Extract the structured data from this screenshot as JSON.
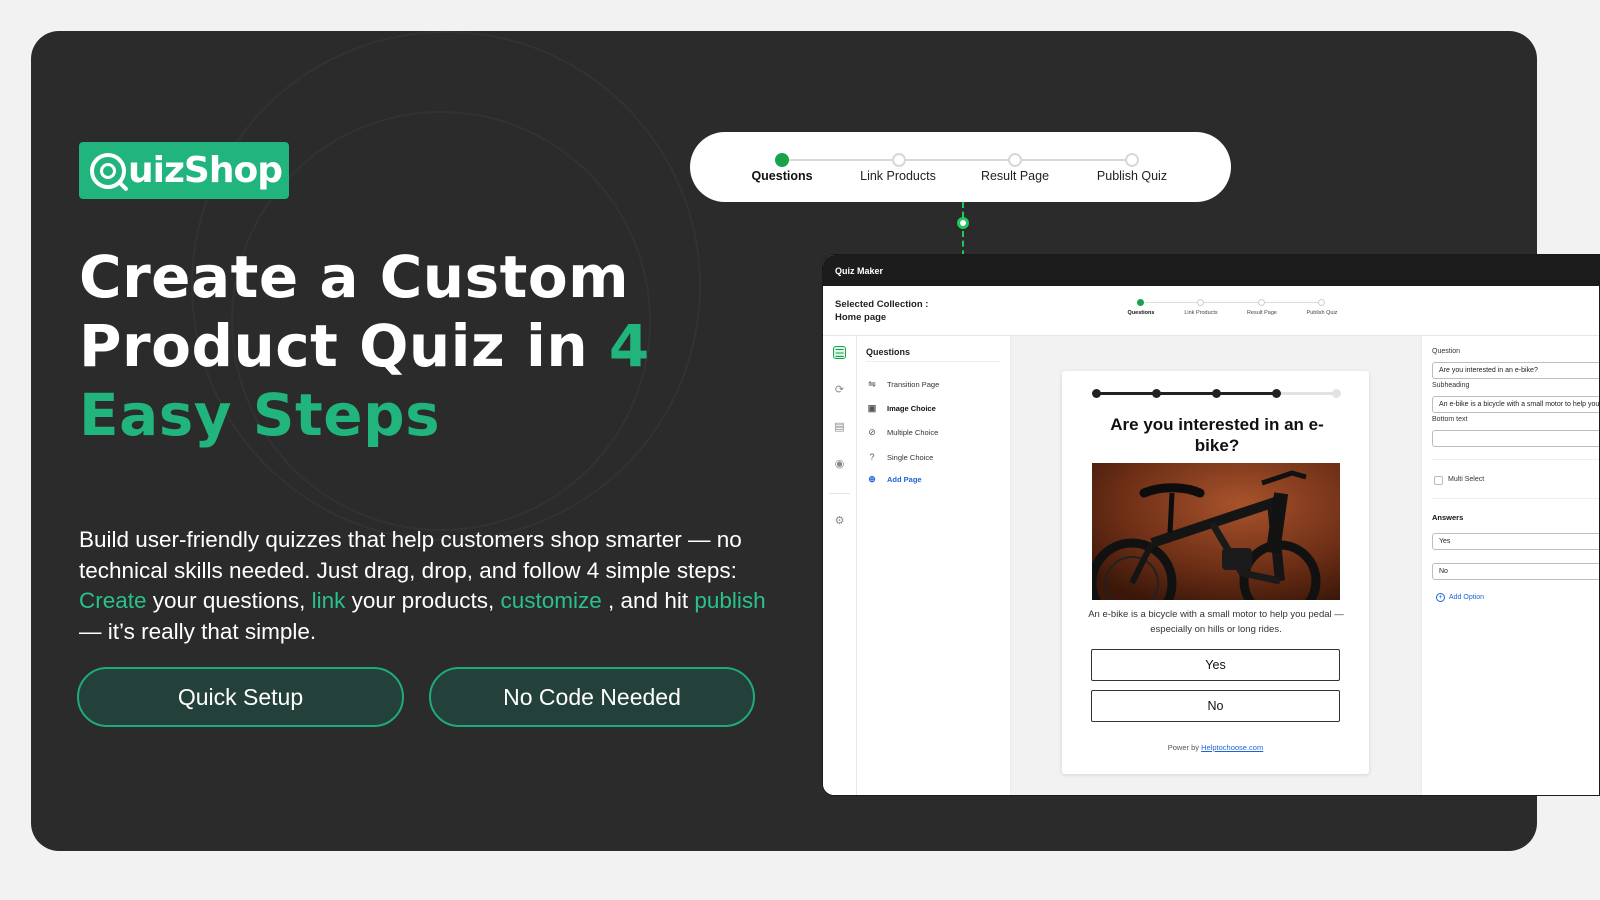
{
  "brand": {
    "logo_text": "uizShop",
    "accent_color": "#21b47c"
  },
  "hero": {
    "title_line1": "Create a Custom",
    "title_line2_pre": "Product Quiz in ",
    "title_line2_accent": "4",
    "title_line3_accent": "Easy Steps"
  },
  "description": {
    "part1": "Build user-friendly quizzes that help customers shop smarter — no technical skills needed. Just drag, drop, and follow 4 simple steps: ",
    "create": "Create",
    "part2": " your questions, ",
    "link": "link",
    "part3": " your products, ",
    "customize": "customize",
    "part4": " , and hit ",
    "publish": "publish",
    "part5": " — it’s really that simple."
  },
  "buttons": {
    "quick_setup": "Quick Setup",
    "no_code": "No Code Needed"
  },
  "stepper": {
    "steps": [
      "Questions",
      "Link Products",
      "Result Page",
      "Publish Quiz"
    ],
    "active_index": 0
  },
  "app": {
    "title": "Quiz Maker",
    "collection_label": "Selected Collection :",
    "collection_value": "Home page",
    "steps": [
      "Questions",
      "Link Products",
      "Result Page",
      "Publish Quiz"
    ],
    "questions_panel": {
      "title": "Questions",
      "items": [
        {
          "icon": "transition-icon",
          "label": "Transition Page"
        },
        {
          "icon": "image-icon",
          "label": "Image Choice"
        },
        {
          "icon": "check-circle-icon",
          "label": "Multiple Choice"
        },
        {
          "icon": "question-circle-icon",
          "label": "Single Choice"
        }
      ],
      "add_page": "Add Page"
    },
    "preview": {
      "progress_fraction": 0.75,
      "question": "Are you interested in an e-bike?",
      "subheading": "An e-bike is a bicycle with a small motor to help you pedal — especially on hills or long rides.",
      "answers": [
        "Yes",
        "No"
      ],
      "powered_prefix": "Power by ",
      "powered_link": "Helptochoose.com"
    },
    "properties": {
      "question_label": "Question",
      "question_value": "Are you interested in an e-bike?",
      "subheading_label": "Subheading",
      "subheading_value": "An e-bike is a bicycle with a small motor to help you pedal",
      "bottom_text_label": "Bottom text",
      "bottom_text_value": "",
      "multi_select_label": "Multi Select",
      "answers_label": "Answers",
      "answers": [
        "Yes",
        "No"
      ],
      "add_option": "Add Option"
    }
  }
}
